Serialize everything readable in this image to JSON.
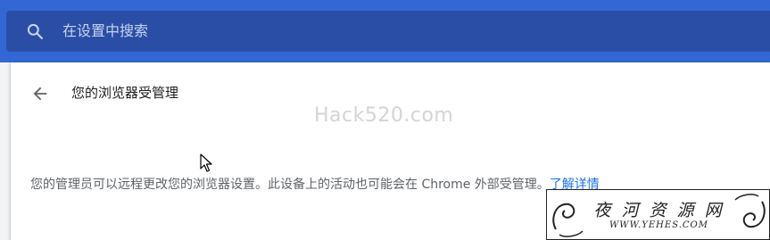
{
  "header": {
    "search_placeholder": "在设置中搜索",
    "search_icon": "search-icon",
    "colors": {
      "bar": "#3367d6",
      "search_box": "#2a4ea6"
    }
  },
  "page": {
    "back_icon": "arrow-left-icon",
    "title": "您的浏览器受管理",
    "description": "您的管理员可以远程更改您的浏览器设置。此设备上的活动也可能会在 Chrome 外部受管理。",
    "learn_more": "了解详情"
  },
  "watermarks": {
    "center": "Hack520.com",
    "corner_title": "夜 河 资 源 网",
    "corner_url": "WWW.YEHES.COM"
  }
}
